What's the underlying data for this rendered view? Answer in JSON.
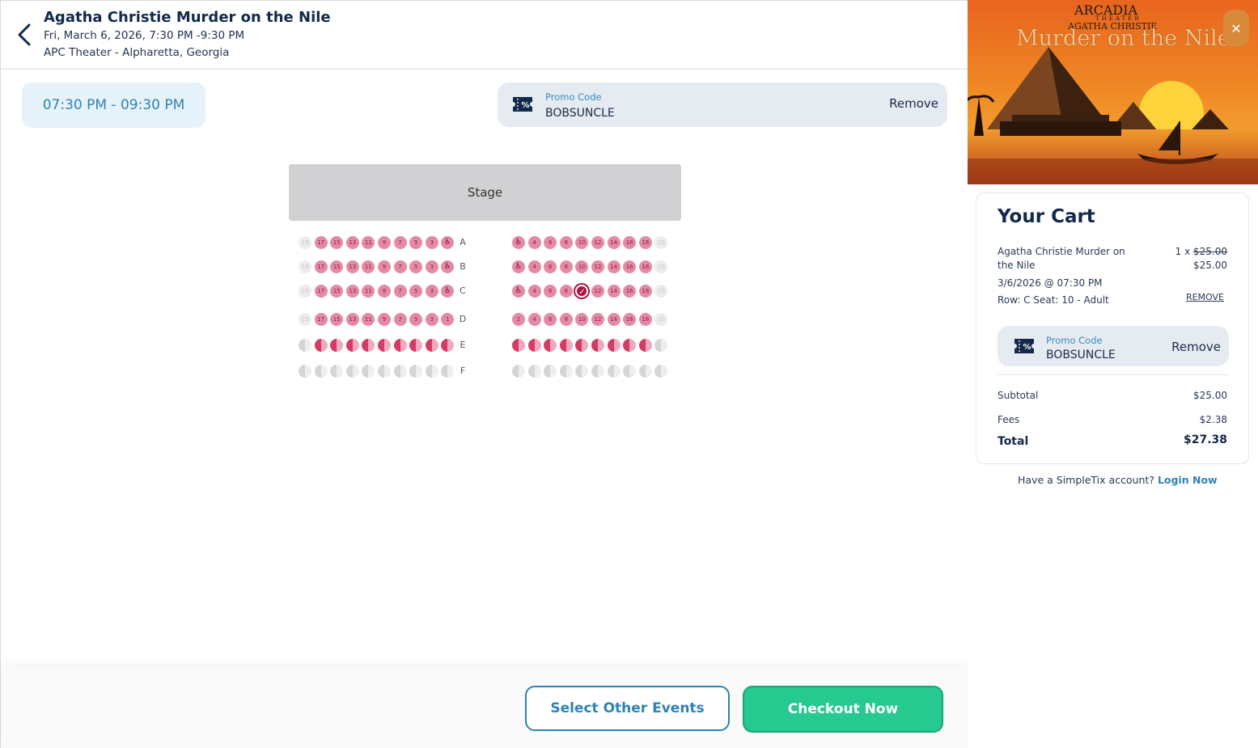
{
  "header": {
    "title": "Agatha Christie Murder on the Nile",
    "datetime": "Fri, March 6, 2026, 7:30 PM -9:30 PM",
    "venue": "APC Theater - Alpharetta, Georgia"
  },
  "time_slot": "07:30 PM - 09:30 PM",
  "promo": {
    "label": "Promo Code",
    "code": "BOBSUNCLE",
    "remove_label": "Remove"
  },
  "stage_label": "Stage",
  "seat_map": {
    "rows": [
      {
        "label": "A",
        "left": [
          "19",
          "17",
          "15",
          "13",
          "11",
          "9",
          "7",
          "5",
          "3",
          "wc"
        ],
        "right": [
          "wc",
          "4",
          "6",
          "8",
          "10",
          "12",
          "14",
          "16",
          "18",
          "20"
        ]
      },
      {
        "label": "B",
        "left": [
          "19",
          "17",
          "15",
          "13",
          "11",
          "9",
          "7",
          "5",
          "3",
          "wc"
        ],
        "right": [
          "wc",
          "4",
          "6",
          "8",
          "10",
          "12",
          "14",
          "16",
          "18",
          "20"
        ]
      },
      {
        "label": "C",
        "left": [
          "19",
          "17",
          "15",
          "13",
          "11",
          "9",
          "7",
          "5",
          "3",
          "wc"
        ],
        "right": [
          "wc",
          "4",
          "6",
          "8",
          "sel",
          "12",
          "14",
          "16",
          "18",
          "20"
        ]
      },
      {
        "label": "D",
        "left": [
          "19",
          "17",
          "15",
          "13",
          "11",
          "9",
          "7",
          "5",
          "3",
          "1"
        ],
        "right": [
          "2",
          "4",
          "6",
          "8",
          "10",
          "12",
          "14",
          "16",
          "18",
          "20"
        ]
      },
      {
        "label": "E",
        "left": [
          "hg",
          "h",
          "h",
          "h",
          "h",
          "h",
          "h",
          "h",
          "h",
          "h"
        ],
        "right": [
          "h",
          "h",
          "h",
          "h",
          "h",
          "h",
          "h",
          "h",
          "h",
          "hg"
        ]
      },
      {
        "label": "F",
        "left": [
          "hg",
          "hg",
          "hg",
          "hg",
          "hg",
          "hg",
          "hg",
          "hg",
          "hg",
          "hg"
        ],
        "right": [
          "hg",
          "hg",
          "hg",
          "hg",
          "hg",
          "hg",
          "hg",
          "hg",
          "hg",
          "hg"
        ]
      }
    ],
    "unavailable": [
      "19",
      "20"
    ],
    "colors": {
      "available": "#e58aa4",
      "selected": "#b3123f",
      "unavailable": "#ececec"
    }
  },
  "footer": {
    "other_events_label": "Select Other Events",
    "checkout_label": "Checkout Now"
  },
  "poster": {
    "brand": "ARCADIA",
    "brand_sub": "THEATER",
    "author": "AGATHA CHRISTIE",
    "title": "Murder on the Nile"
  },
  "cart": {
    "title": "Your Cart",
    "item": {
      "name": "Agatha Christie Murder on the Nile",
      "qty_prefix": "1 x ",
      "original_price": "$25.00",
      "price": "$25.00",
      "date": "3/6/2026 @ 07:30 PM",
      "seat": "Row: C Seat: 10 - Adult",
      "remove_label": "REMOVE"
    },
    "subtotal_label": "Subtotal",
    "subtotal": "$25.00",
    "fees_label": "Fees",
    "fees": "$2.38",
    "total_label": "Total",
    "total": "$27.38"
  },
  "account": {
    "prompt": "Have a SimpleTix account?",
    "login_label": "Login Now"
  },
  "icons": {
    "back": "chevron-left-icon",
    "close": "close-icon",
    "promo": "ticket-percent-icon",
    "wheelchair": "wheelchair-icon",
    "check": "check-icon"
  },
  "colors": {
    "accent": "#2f82b4",
    "checkout": "#26c98f",
    "title": "#13294b"
  }
}
